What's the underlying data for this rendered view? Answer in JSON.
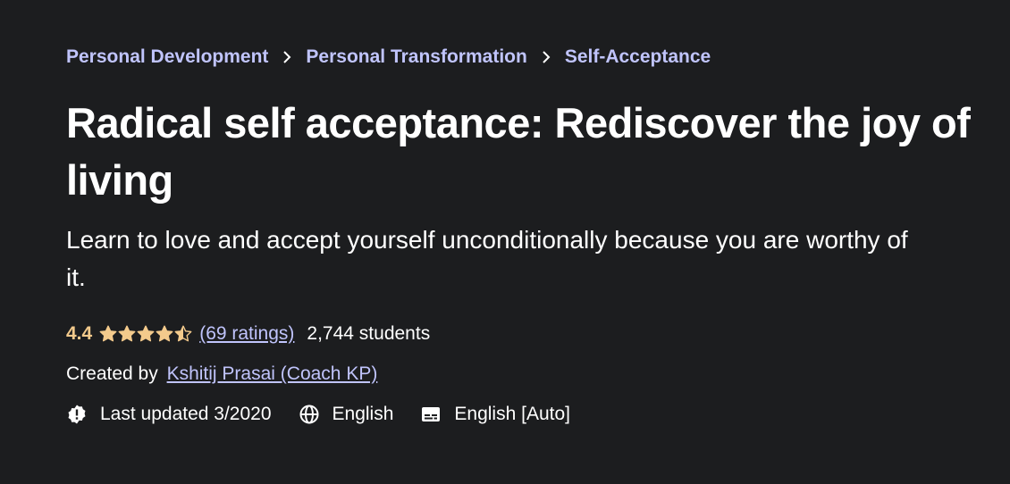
{
  "breadcrumb": {
    "items": [
      "Personal Development",
      "Personal Transformation",
      "Self-Acceptance"
    ]
  },
  "course": {
    "title": "Radical self acceptance: Rediscover the joy of living",
    "subtitle": "Learn to love and accept yourself unconditionally because you are worthy of it."
  },
  "rating": {
    "value": "4.4",
    "stars_filled": 4.4,
    "stars_max": 5,
    "ratings_link": "(69 ratings)",
    "students": "2,744 students"
  },
  "creator": {
    "prefix": "Created by",
    "name": "Kshitij Prasai (Coach KP)"
  },
  "meta": {
    "last_updated": "Last updated 3/2020",
    "language": "English",
    "captions": "English [Auto]"
  },
  "icons": {
    "breadcrumb_separator": "chevron-right-icon",
    "last_updated": "alert-badge-icon",
    "language": "globe-icon",
    "captions": "closed-captions-icon"
  },
  "colors": {
    "background": "#1c1d1f",
    "link": "#c0c4fc",
    "rating": "#f3ca8c",
    "star": "#f3ca8c"
  }
}
